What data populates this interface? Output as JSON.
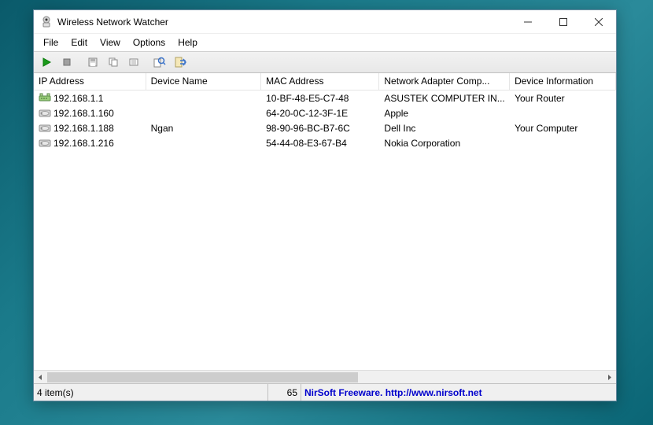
{
  "window": {
    "title": "Wireless Network Watcher"
  },
  "menu": {
    "file": "File",
    "edit": "Edit",
    "view": "View",
    "options": "Options",
    "help": "Help"
  },
  "columns": {
    "ip": "IP Address",
    "device": "Device Name",
    "mac": "MAC Address",
    "company": "Network Adapter Comp...",
    "info": "Device Information"
  },
  "rows": [
    {
      "icon": "router",
      "ip": "192.168.1.1",
      "device": "",
      "mac": "10-BF-48-E5-C7-48",
      "company": "ASUSTEK COMPUTER IN...",
      "info": "Your Router"
    },
    {
      "icon": "device",
      "ip": "192.168.1.160",
      "device": "",
      "mac": "64-20-0C-12-3F-1E",
      "company": "Apple",
      "info": ""
    },
    {
      "icon": "device",
      "ip": "192.168.1.188",
      "device": "Ngan",
      "mac": "98-90-96-BC-B7-6C",
      "company": "Dell Inc",
      "info": "Your Computer"
    },
    {
      "icon": "device",
      "ip": "192.168.1.216",
      "device": "",
      "mac": "54-44-08-E3-67-B4",
      "company": "Nokia Corporation",
      "info": ""
    }
  ],
  "status": {
    "items": "4 item(s)",
    "count": "65",
    "credit": "NirSoft Freeware.  http://www.nirsoft.net"
  }
}
